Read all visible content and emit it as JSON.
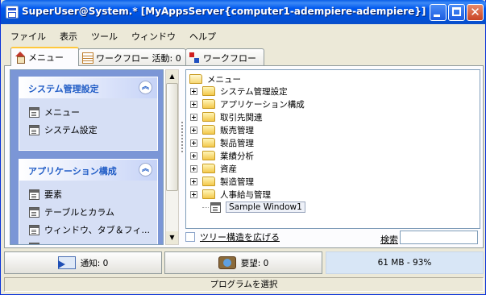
{
  "window": {
    "title": "SuperUser@System.* [MyAppsServer{computer1-adempiere-adempiere}]",
    "close_glyph": "✕"
  },
  "menubar": [
    {
      "label": "ファイル"
    },
    {
      "label": "表示"
    },
    {
      "label": "ツール"
    },
    {
      "label": "ウィンドウ"
    },
    {
      "label": "ヘルプ"
    }
  ],
  "tabs": [
    {
      "label": "メニュー",
      "icon": "home-icon"
    },
    {
      "label": "ワークフロー 活動: 0",
      "icon": "grid-icon"
    },
    {
      "label": "ワークフロー",
      "icon": "workflow-icon"
    }
  ],
  "taskpane": {
    "sections": [
      {
        "title": "システム管理設定",
        "items": [
          "メニュー",
          "システム設定"
        ]
      },
      {
        "title": "アプリケーション構成",
        "items": [
          "要素",
          "テーブルとカラム",
          "ウィンドウ、タブ＆フィ...",
          ""
        ]
      }
    ],
    "collapse_glyph": "︽"
  },
  "scrollbar": {
    "up": "▲",
    "down": "▼"
  },
  "tree": {
    "root": "メニュー",
    "nodes": [
      "システム管理設定",
      "アプリケーション構成",
      "取引先関連",
      "販売管理",
      "製品管理",
      "業績分析",
      "資産",
      "製造管理",
      "人事給与管理"
    ],
    "selected_leaf": "Sample Window1"
  },
  "expand_tree_label": "ツリー構造を広げる",
  "search": {
    "label": "検索",
    "value": ""
  },
  "bottom": {
    "notice": "通知: 0",
    "request": "要望: 0",
    "memory": "61 MB - 93%"
  },
  "status": "プログラムを選択"
}
